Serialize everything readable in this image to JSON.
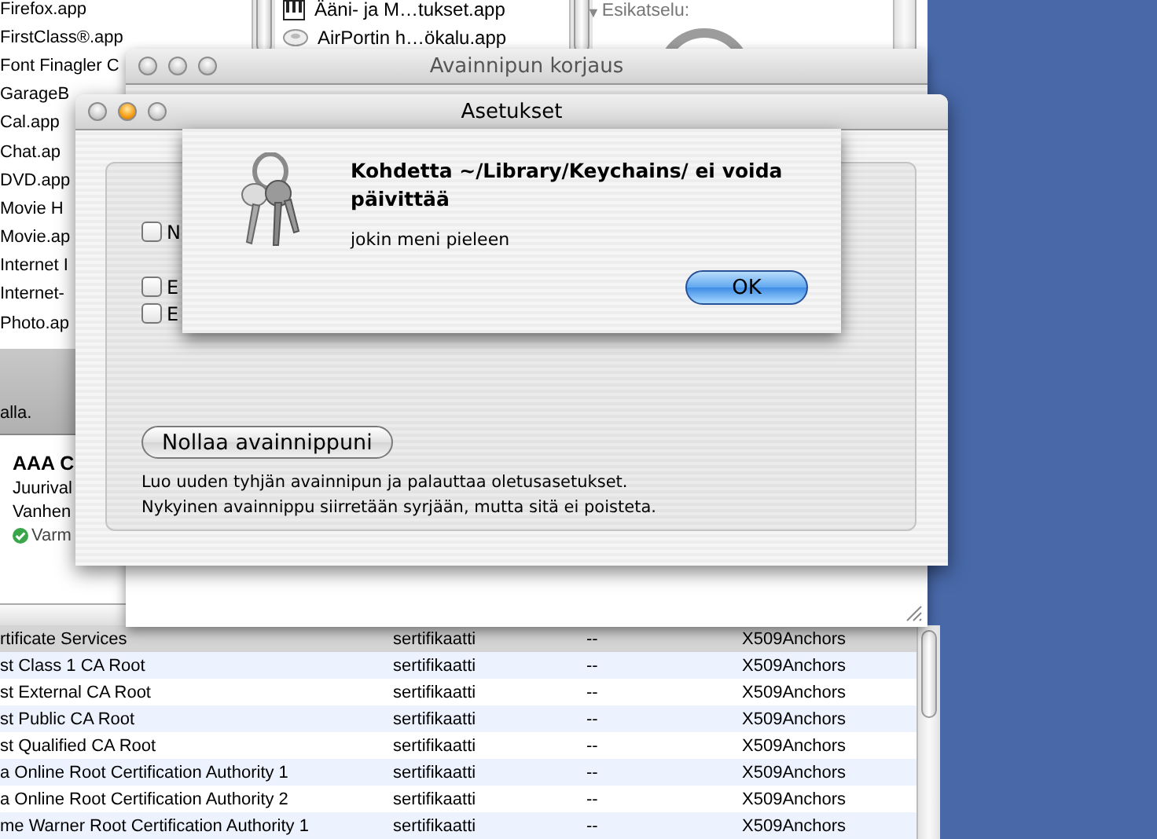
{
  "finder": {
    "file_list": [
      {
        "name": "Firefox.app"
      },
      {
        "name": "FirstClass®.app"
      },
      {
        "name": "Font Finagler C"
      },
      {
        "name": "GarageB"
      },
      {
        "name": "Cal.app"
      },
      {
        "name": "Chat.ap"
      },
      {
        "name": "DVD.app"
      },
      {
        "name": "Movie H"
      },
      {
        "name": "Movie.ap"
      },
      {
        "name": "Internet I"
      },
      {
        "name": "Internet-"
      },
      {
        "name": "Photo.ap"
      }
    ],
    "column_2": [
      {
        "name": "Ääni- ja M…tukset.app",
        "kind": "app"
      },
      {
        "name": "AirPortin h…ökalu.app",
        "kind": "utility"
      }
    ],
    "preview": {
      "disclosure": "▼",
      "label": "Esikatselu:"
    }
  },
  "keychain_window": {
    "banner_text": "alla.",
    "certificate": {
      "name": "AAA C",
      "line_1": "Juurival",
      "line_2": "Vanhen",
      "status": "Varm"
    },
    "table": {
      "rows": [
        {
          "name": "rtificate Services",
          "kind": "sertifikaatti",
          "column_3": "--",
          "keychain": "X509Anchors",
          "selected": true
        },
        {
          "name": "st Class 1 CA Root",
          "kind": "sertifikaatti",
          "column_3": "--",
          "keychain": "X509Anchors",
          "selected": false
        },
        {
          "name": "st External CA Root",
          "kind": "sertifikaatti",
          "column_3": "--",
          "keychain": "X509Anchors",
          "selected": false
        },
        {
          "name": "st Public CA Root",
          "kind": "sertifikaatti",
          "column_3": "--",
          "keychain": "X509Anchors",
          "selected": false
        },
        {
          "name": "st Qualified CA Root",
          "kind": "sertifikaatti",
          "column_3": "--",
          "keychain": "X509Anchors",
          "selected": false
        },
        {
          "name": "a Online Root Certification Authority 1",
          "kind": "sertifikaatti",
          "column_3": "--",
          "keychain": "X509Anchors",
          "selected": false
        },
        {
          "name": "a Online Root Certification Authority 2",
          "kind": "sertifikaatti",
          "column_3": "--",
          "keychain": "X509Anchors",
          "selected": false
        },
        {
          "name": "me Warner Root Certification Authority 1",
          "kind": "sertifikaatti",
          "column_3": "--",
          "keychain": "X509Anchors",
          "selected": false
        }
      ]
    }
  },
  "repair_window": {
    "title": "Avainnipun korjaus"
  },
  "settings_window": {
    "title": "Asetukset",
    "checkboxes": [
      {
        "label": "N",
        "checked": false
      },
      {
        "label": "E",
        "checked": false
      },
      {
        "label": "E",
        "checked": false
      }
    ],
    "reset_button": "Nollaa avainnippuni",
    "reset_description": "Luo uuden tyhjän avainnipun ja palauttaa oletusasetukset.\nNykyinen avainnippu siirretään syrjään, mutta sitä ei poisteta."
  },
  "alert": {
    "title": "Kohdetta ~/Library/Keychains/ ei voida päivittää",
    "message": "jokin meni pieleen",
    "button": "OK"
  }
}
